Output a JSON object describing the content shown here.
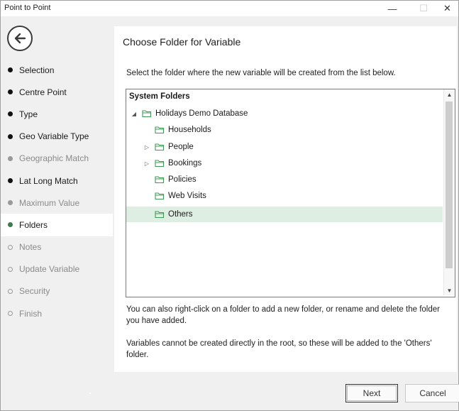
{
  "window": {
    "title": "Point to Point",
    "minimize_glyph": "—",
    "maximize_glyph": "☐",
    "close_glyph": "✕"
  },
  "nav": {
    "items": [
      {
        "label": "Selection",
        "state": "done"
      },
      {
        "label": "Centre Point",
        "state": "done"
      },
      {
        "label": "Type",
        "state": "done"
      },
      {
        "label": "Geo Variable Type",
        "state": "done"
      },
      {
        "label": "Geographic Match",
        "state": "skipped"
      },
      {
        "label": "Lat Long Match",
        "state": "done"
      },
      {
        "label": "Maximum Value",
        "state": "skipped"
      },
      {
        "label": "Folders",
        "state": "current"
      },
      {
        "label": "Notes",
        "state": "todo"
      },
      {
        "label": "Update Variable",
        "state": "todo"
      },
      {
        "label": "Security",
        "state": "todo"
      },
      {
        "label": "Finish",
        "state": "todo"
      }
    ]
  },
  "main": {
    "heading": "Choose Folder for Variable",
    "instruction": "Select the folder where the new variable will be created from the list below.",
    "tree": {
      "root_label": "System Folders",
      "nodes": [
        {
          "label": "Holidays Demo Database",
          "level": 0,
          "expander": "expanded"
        },
        {
          "label": "Households",
          "level": 1,
          "expander": "none"
        },
        {
          "label": "People",
          "level": 1,
          "expander": "collapsed"
        },
        {
          "label": "Bookings",
          "level": 1,
          "expander": "collapsed"
        },
        {
          "label": "Policies",
          "level": 1,
          "expander": "none"
        },
        {
          "label": "Web Visits",
          "level": 1,
          "expander": "none"
        },
        {
          "label": "Others",
          "level": 1,
          "expander": "none",
          "selected": true
        }
      ]
    },
    "note1": "You can also right-click on a folder to add a new folder, or rename and delete the folder you have added.",
    "note2": "Variables cannot be created directly in the root, so these will be added to the 'Others' folder."
  },
  "footer": {
    "next_label": "Next",
    "cancel_label": "Cancel"
  },
  "colors": {
    "accent_green": "#3f7b4c",
    "selection_bg": "#dfeee3",
    "folder_green": "#3f9a54"
  }
}
